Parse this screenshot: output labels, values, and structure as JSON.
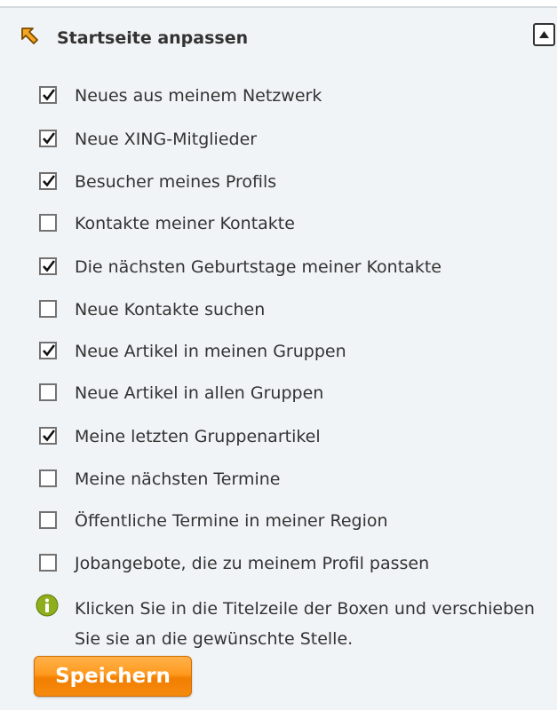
{
  "panel": {
    "title": "Startseite anpassen",
    "header_icon": "move-arrow-icon",
    "collapse_icon": "collapse-up-icon"
  },
  "options": [
    {
      "label": "Neues aus meinem Netzwerk",
      "checked": true
    },
    {
      "label": "Neue XING-Mitglieder",
      "checked": true
    },
    {
      "label": "Besucher meines Profils",
      "checked": true
    },
    {
      "label": "Kontakte meiner Kontakte",
      "checked": false
    },
    {
      "label": "Die nächsten Geburtstage meiner Kontakte",
      "checked": true
    },
    {
      "label": "Neue Kontakte suchen",
      "checked": false
    },
    {
      "label": "Neue Artikel in meinen Gruppen",
      "checked": true
    },
    {
      "label": "Neue Artikel in allen Gruppen",
      "checked": false
    },
    {
      "label": "Meine letzten Gruppenartikel",
      "checked": true
    },
    {
      "label": "Meine nächsten Termine",
      "checked": false
    },
    {
      "label": "Öffentliche Termine in meiner Region",
      "checked": false
    },
    {
      "label": "Jobangebote, die zu meinem Profil passen",
      "checked": false
    }
  ],
  "info": {
    "icon": "info-icon",
    "text": "Klicken Sie in die Titelzeile der Boxen und verschieben Sie sie an die gewünschte Stelle."
  },
  "save_button": {
    "label": "Speichern"
  },
  "colors": {
    "panel_background": "#f1f4f6",
    "button_orange": "#ff9a1f",
    "info_icon_green": "#8fae1b",
    "text": "#333333"
  }
}
